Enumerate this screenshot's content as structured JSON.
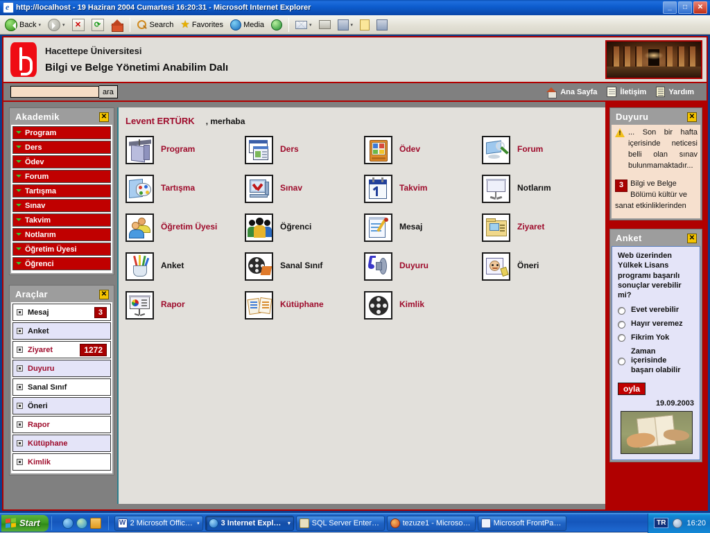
{
  "window": {
    "title": "http://localhost - 19 Haziran 2004 Cumartesi 16:20:31 - Microsoft Internet Explorer",
    "minimize_label": "_",
    "maximize_label": "□",
    "close_label": "✕"
  },
  "toolbar": {
    "back_label": "Back",
    "search_label": "Search",
    "favorites_label": "Favorites",
    "media_label": "Media",
    "dropdown_glyph": "▾"
  },
  "site_header": {
    "line1": "Hacettepe Üniversitesi",
    "line2": "Bilgi ve Belge Yönetimi Anabilim Dalı"
  },
  "search": {
    "value": "",
    "placeholder": "",
    "button_label": "ara"
  },
  "header_links": [
    {
      "label": "Ana Sayfa",
      "icon": "home-icon"
    },
    {
      "label": "İletişim",
      "icon": "form-icon"
    },
    {
      "label": "Yardım",
      "icon": "help-icon"
    }
  ],
  "akademik_panel": {
    "title": "Akademik",
    "close_label": "✕",
    "items": [
      {
        "label": "Program"
      },
      {
        "label": "Ders"
      },
      {
        "label": "Ödev"
      },
      {
        "label": "Forum"
      },
      {
        "label": "Tartışma"
      },
      {
        "label": "Sınav"
      },
      {
        "label": "Takvim"
      },
      {
        "label": "Notlarım"
      },
      {
        "label": "Öğretim Üyesi"
      },
      {
        "label": "Öğrenci"
      }
    ]
  },
  "araclar_panel": {
    "title": "Araçlar",
    "close_label": "✕",
    "items": [
      {
        "label": "Mesaj",
        "badge": "3",
        "color": "black",
        "shade": "white"
      },
      {
        "label": "Anket",
        "badge": "",
        "color": "black",
        "shade": "lavender"
      },
      {
        "label": "Ziyaret",
        "badge": "1272",
        "color": "red",
        "shade": "white"
      },
      {
        "label": "Duyuru",
        "badge": "",
        "color": "red",
        "shade": "lavender"
      },
      {
        "label": "Sanal Sınıf",
        "badge": "",
        "color": "black",
        "shade": "white"
      },
      {
        "label": "Öneri",
        "badge": "",
        "color": "black",
        "shade": "lavender"
      },
      {
        "label": "Rapor",
        "badge": "",
        "color": "red",
        "shade": "white"
      },
      {
        "label": "Kütüphane",
        "badge": "",
        "color": "red",
        "shade": "lavender"
      },
      {
        "label": "Kimlik",
        "badge": "",
        "color": "red",
        "shade": "white"
      }
    ]
  },
  "main": {
    "user_name": "Levent ERTÜRK",
    "greeting": ",  merhaba",
    "shortcuts": [
      {
        "label": "Program",
        "icon": "lectern-icon",
        "color": "red"
      },
      {
        "label": "Ders",
        "icon": "windows-icon",
        "color": "red"
      },
      {
        "label": "Ödev",
        "icon": "organizer-icon",
        "color": "red"
      },
      {
        "label": "Forum",
        "icon": "magnifier-icon",
        "color": "red"
      },
      {
        "label": "Tartışma",
        "icon": "palette-icon",
        "color": "red"
      },
      {
        "label": "Sınav",
        "icon": "monitor-check-icon",
        "color": "red"
      },
      {
        "label": "Takvim",
        "icon": "calendar-icon",
        "color": "red"
      },
      {
        "label": "Notlarım",
        "icon": "whiteboard-icon",
        "color": "black"
      },
      {
        "label": "Öğretim Üyesi",
        "icon": "two-people-icon",
        "color": "red"
      },
      {
        "label": "Öğrenci",
        "icon": "group-icon",
        "color": "black"
      },
      {
        "label": "Mesaj",
        "icon": "notepad-pen-icon",
        "color": "black"
      },
      {
        "label": "Ziyaret",
        "icon": "folder-card-icon",
        "color": "red"
      },
      {
        "label": "Anket",
        "icon": "pencil-cup-icon",
        "color": "black"
      },
      {
        "label": "Sanal Sınıf",
        "icon": "film-reel-icon",
        "color": "black"
      },
      {
        "label": "Duyuru",
        "icon": "speaker-note-icon",
        "color": "red"
      },
      {
        "label": "Öneri",
        "icon": "face-idea-icon",
        "color": "black"
      },
      {
        "label": "Rapor",
        "icon": "chart-board-icon",
        "color": "red"
      },
      {
        "label": "Kütüphane",
        "icon": "open-book-icon",
        "color": "red"
      },
      {
        "label": "Kimlik",
        "icon": "film-reel2-icon",
        "color": "red"
      }
    ]
  },
  "duyuru_panel": {
    "title": "Duyuru",
    "close_label": "✕",
    "item1_text": "... Son bir hafta içerisinde neticesi belli olan sınav bulunmamaktadır...",
    "item2_badge": "3",
    "item2_text": "Bilgi ve Belge Bölümü kültür ve sanat etkinliklerinden"
  },
  "anket_panel": {
    "title": "Anket",
    "close_label": "✕",
    "question": "Web üzerinden Yülkek Lisans programı başarılı sonuçlar verebilir mi?",
    "options": [
      {
        "label": "Evet verebilir"
      },
      {
        "label": "Hayır veremez"
      },
      {
        "label": "Fikrim Yok"
      },
      {
        "label": "Zaman içerisinde başarı olabilir"
      }
    ],
    "vote_button": "oyla",
    "date": "19.09.2003"
  },
  "taskbar": {
    "start_label": "Start",
    "tasks": [
      {
        "label": "2 Microsoft Office ...",
        "icon": "word-icon",
        "active": false
      },
      {
        "label": "3 Internet Explor...",
        "icon": "ie-icon",
        "active": true
      },
      {
        "label": "SQL Server Enterpris...",
        "icon": "sql-icon",
        "active": false
      },
      {
        "label": "tezuze1 - Microsoft V...",
        "icon": "visio-icon",
        "active": false
      },
      {
        "label": "Microsoft FrontPage ...",
        "icon": "frontpage-icon",
        "active": false
      }
    ],
    "dropdown_glyph": "▾",
    "language": "TR",
    "clock": "16:20"
  }
}
